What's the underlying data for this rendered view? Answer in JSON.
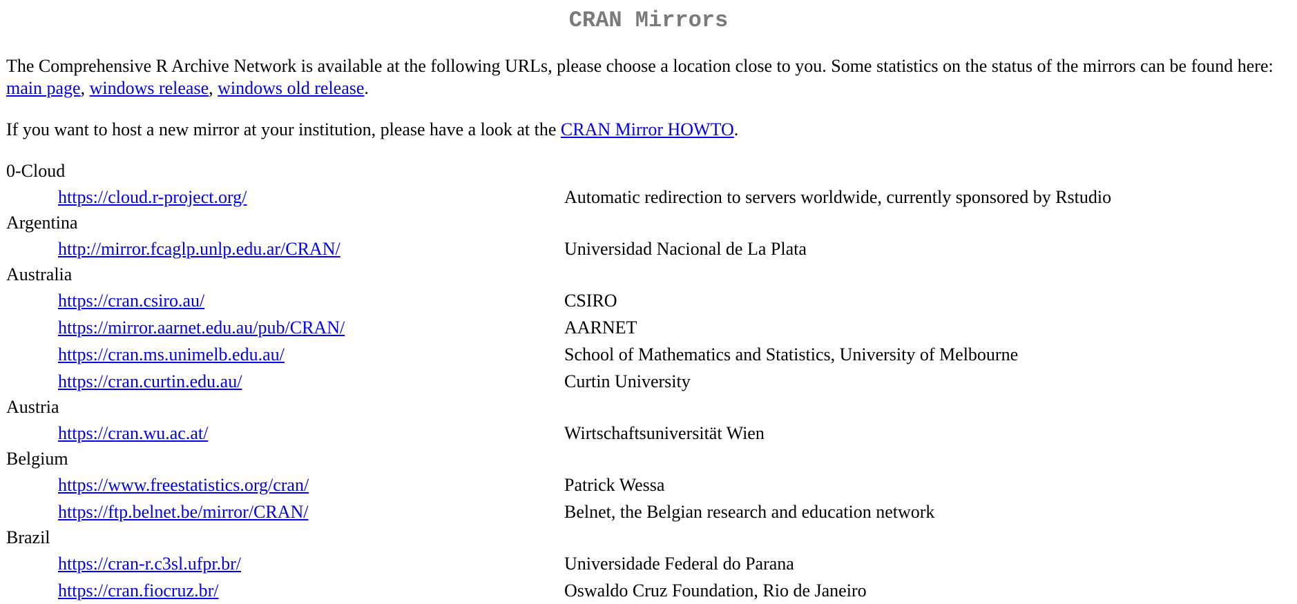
{
  "title": "CRAN Mirrors",
  "intro": {
    "text_before": "The Comprehensive R Archive Network is available at the following URLs, please choose a location close to you. Some statistics on the status of the mirrors can be found here: ",
    "links": [
      "main page",
      "windows release",
      "windows old release"
    ],
    "sep1": ", ",
    "sep2": ", ",
    "text_after": "."
  },
  "howto": {
    "text_before": "If you want to host a new mirror at your institution, please have a look at the ",
    "link": "CRAN Mirror HOWTO",
    "text_after": "."
  },
  "countries": [
    {
      "name": "0-Cloud",
      "mirrors": [
        {
          "url": "https://cloud.r-project.org/",
          "desc": "Automatic redirection to servers worldwide, currently sponsored by Rstudio"
        }
      ]
    },
    {
      "name": "Argentina",
      "mirrors": [
        {
          "url": "http://mirror.fcaglp.unlp.edu.ar/CRAN/",
          "desc": "Universidad Nacional de La Plata"
        }
      ]
    },
    {
      "name": "Australia",
      "mirrors": [
        {
          "url": "https://cran.csiro.au/",
          "desc": "CSIRO"
        },
        {
          "url": "https://mirror.aarnet.edu.au/pub/CRAN/",
          "desc": "AARNET"
        },
        {
          "url": "https://cran.ms.unimelb.edu.au/",
          "desc": "School of Mathematics and Statistics, University of Melbourne"
        },
        {
          "url": "https://cran.curtin.edu.au/",
          "desc": "Curtin University"
        }
      ]
    },
    {
      "name": "Austria",
      "mirrors": [
        {
          "url": "https://cran.wu.ac.at/",
          "desc": "Wirtschaftsuniversität Wien"
        }
      ]
    },
    {
      "name": "Belgium",
      "mirrors": [
        {
          "url": "https://www.freestatistics.org/cran/",
          "desc": "Patrick Wessa"
        },
        {
          "url": "https://ftp.belnet.be/mirror/CRAN/",
          "desc": "Belnet, the Belgian research and education network"
        }
      ]
    },
    {
      "name": "Brazil",
      "mirrors": [
        {
          "url": "https://cran-r.c3sl.ufpr.br/",
          "desc": "Universidade Federal do Parana"
        },
        {
          "url": "https://cran.fiocruz.br/",
          "desc": "Oswaldo Cruz Foundation, Rio de Janeiro"
        }
      ]
    }
  ]
}
